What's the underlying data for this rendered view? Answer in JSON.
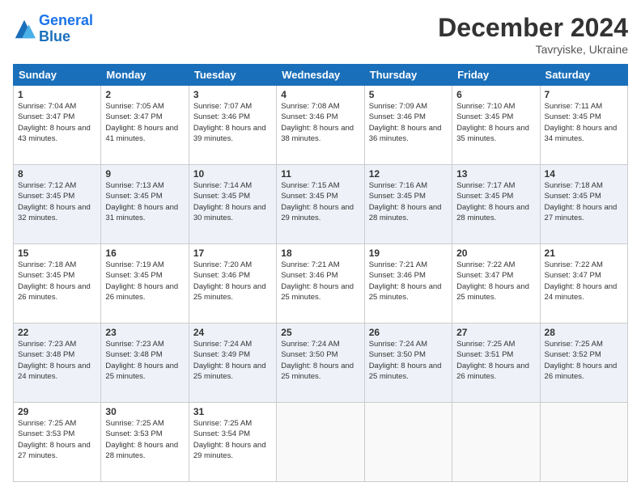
{
  "logo": {
    "line1": "General",
    "line2": "Blue"
  },
  "header": {
    "month_year": "December 2024",
    "location": "Tavryiske, Ukraine"
  },
  "weekdays": [
    "Sunday",
    "Monday",
    "Tuesday",
    "Wednesday",
    "Thursday",
    "Friday",
    "Saturday"
  ],
  "weeks": [
    [
      {
        "day": "1",
        "sunrise": "Sunrise: 7:04 AM",
        "sunset": "Sunset: 3:47 PM",
        "daylight": "Daylight: 8 hours and 43 minutes."
      },
      {
        "day": "2",
        "sunrise": "Sunrise: 7:05 AM",
        "sunset": "Sunset: 3:47 PM",
        "daylight": "Daylight: 8 hours and 41 minutes."
      },
      {
        "day": "3",
        "sunrise": "Sunrise: 7:07 AM",
        "sunset": "Sunset: 3:46 PM",
        "daylight": "Daylight: 8 hours and 39 minutes."
      },
      {
        "day": "4",
        "sunrise": "Sunrise: 7:08 AM",
        "sunset": "Sunset: 3:46 PM",
        "daylight": "Daylight: 8 hours and 38 minutes."
      },
      {
        "day": "5",
        "sunrise": "Sunrise: 7:09 AM",
        "sunset": "Sunset: 3:46 PM",
        "daylight": "Daylight: 8 hours and 36 minutes."
      },
      {
        "day": "6",
        "sunrise": "Sunrise: 7:10 AM",
        "sunset": "Sunset: 3:45 PM",
        "daylight": "Daylight: 8 hours and 35 minutes."
      },
      {
        "day": "7",
        "sunrise": "Sunrise: 7:11 AM",
        "sunset": "Sunset: 3:45 PM",
        "daylight": "Daylight: 8 hours and 34 minutes."
      }
    ],
    [
      {
        "day": "8",
        "sunrise": "Sunrise: 7:12 AM",
        "sunset": "Sunset: 3:45 PM",
        "daylight": "Daylight: 8 hours and 32 minutes."
      },
      {
        "day": "9",
        "sunrise": "Sunrise: 7:13 AM",
        "sunset": "Sunset: 3:45 PM",
        "daylight": "Daylight: 8 hours and 31 minutes."
      },
      {
        "day": "10",
        "sunrise": "Sunrise: 7:14 AM",
        "sunset": "Sunset: 3:45 PM",
        "daylight": "Daylight: 8 hours and 30 minutes."
      },
      {
        "day": "11",
        "sunrise": "Sunrise: 7:15 AM",
        "sunset": "Sunset: 3:45 PM",
        "daylight": "Daylight: 8 hours and 29 minutes."
      },
      {
        "day": "12",
        "sunrise": "Sunrise: 7:16 AM",
        "sunset": "Sunset: 3:45 PM",
        "daylight": "Daylight: 8 hours and 28 minutes."
      },
      {
        "day": "13",
        "sunrise": "Sunrise: 7:17 AM",
        "sunset": "Sunset: 3:45 PM",
        "daylight": "Daylight: 8 hours and 28 minutes."
      },
      {
        "day": "14",
        "sunrise": "Sunrise: 7:18 AM",
        "sunset": "Sunset: 3:45 PM",
        "daylight": "Daylight: 8 hours and 27 minutes."
      }
    ],
    [
      {
        "day": "15",
        "sunrise": "Sunrise: 7:18 AM",
        "sunset": "Sunset: 3:45 PM",
        "daylight": "Daylight: 8 hours and 26 minutes."
      },
      {
        "day": "16",
        "sunrise": "Sunrise: 7:19 AM",
        "sunset": "Sunset: 3:45 PM",
        "daylight": "Daylight: 8 hours and 26 minutes."
      },
      {
        "day": "17",
        "sunrise": "Sunrise: 7:20 AM",
        "sunset": "Sunset: 3:46 PM",
        "daylight": "Daylight: 8 hours and 25 minutes."
      },
      {
        "day": "18",
        "sunrise": "Sunrise: 7:21 AM",
        "sunset": "Sunset: 3:46 PM",
        "daylight": "Daylight: 8 hours and 25 minutes."
      },
      {
        "day": "19",
        "sunrise": "Sunrise: 7:21 AM",
        "sunset": "Sunset: 3:46 PM",
        "daylight": "Daylight: 8 hours and 25 minutes."
      },
      {
        "day": "20",
        "sunrise": "Sunrise: 7:22 AM",
        "sunset": "Sunset: 3:47 PM",
        "daylight": "Daylight: 8 hours and 25 minutes."
      },
      {
        "day": "21",
        "sunrise": "Sunrise: 7:22 AM",
        "sunset": "Sunset: 3:47 PM",
        "daylight": "Daylight: 8 hours and 24 minutes."
      }
    ],
    [
      {
        "day": "22",
        "sunrise": "Sunrise: 7:23 AM",
        "sunset": "Sunset: 3:48 PM",
        "daylight": "Daylight: 8 hours and 24 minutes."
      },
      {
        "day": "23",
        "sunrise": "Sunrise: 7:23 AM",
        "sunset": "Sunset: 3:48 PM",
        "daylight": "Daylight: 8 hours and 25 minutes."
      },
      {
        "day": "24",
        "sunrise": "Sunrise: 7:24 AM",
        "sunset": "Sunset: 3:49 PM",
        "daylight": "Daylight: 8 hours and 25 minutes."
      },
      {
        "day": "25",
        "sunrise": "Sunrise: 7:24 AM",
        "sunset": "Sunset: 3:50 PM",
        "daylight": "Daylight: 8 hours and 25 minutes."
      },
      {
        "day": "26",
        "sunrise": "Sunrise: 7:24 AM",
        "sunset": "Sunset: 3:50 PM",
        "daylight": "Daylight: 8 hours and 25 minutes."
      },
      {
        "day": "27",
        "sunrise": "Sunrise: 7:25 AM",
        "sunset": "Sunset: 3:51 PM",
        "daylight": "Daylight: 8 hours and 26 minutes."
      },
      {
        "day": "28",
        "sunrise": "Sunrise: 7:25 AM",
        "sunset": "Sunset: 3:52 PM",
        "daylight": "Daylight: 8 hours and 26 minutes."
      }
    ],
    [
      {
        "day": "29",
        "sunrise": "Sunrise: 7:25 AM",
        "sunset": "Sunset: 3:53 PM",
        "daylight": "Daylight: 8 hours and 27 minutes."
      },
      {
        "day": "30",
        "sunrise": "Sunrise: 7:25 AM",
        "sunset": "Sunset: 3:53 PM",
        "daylight": "Daylight: 8 hours and 28 minutes."
      },
      {
        "day": "31",
        "sunrise": "Sunrise: 7:25 AM",
        "sunset": "Sunset: 3:54 PM",
        "daylight": "Daylight: 8 hours and 29 minutes."
      },
      null,
      null,
      null,
      null
    ]
  ]
}
